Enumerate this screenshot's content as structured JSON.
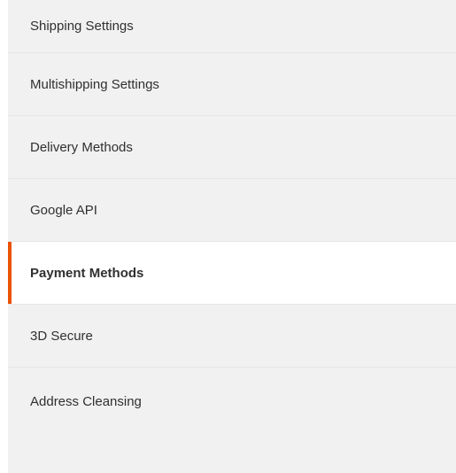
{
  "nav": {
    "items": [
      {
        "label": "Shipping Settings",
        "active": false
      },
      {
        "label": "Multishipping Settings",
        "active": false
      },
      {
        "label": "Delivery Methods",
        "active": false
      },
      {
        "label": "Google API",
        "active": false
      },
      {
        "label": "Payment Methods",
        "active": true
      },
      {
        "label": "3D Secure",
        "active": false
      },
      {
        "label": "Address Cleansing",
        "active": false
      }
    ]
  },
  "colors": {
    "accent": "#eb5202",
    "nav_background": "#f1f1f1",
    "active_background": "#ffffff",
    "text": "#303030"
  }
}
